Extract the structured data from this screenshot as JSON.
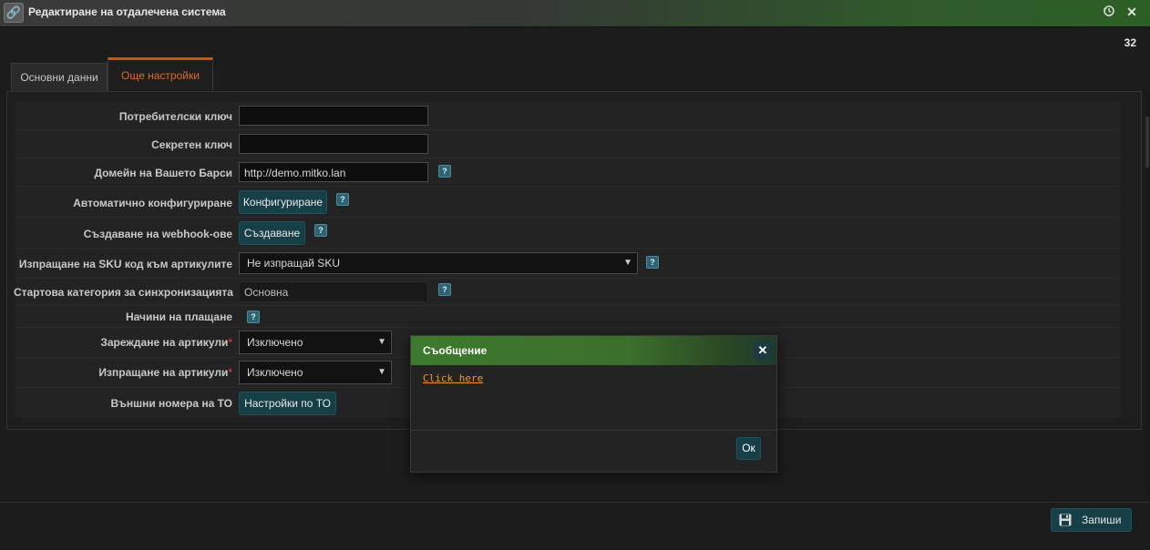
{
  "window": {
    "title": "Редактиране на отдалечена система",
    "record_id": "32"
  },
  "tabs": [
    {
      "label": "Основни данни",
      "active": false
    },
    {
      "label": "Още настройки",
      "active": true
    }
  ],
  "form": {
    "consumer_key": {
      "label": "Потребителски ключ",
      "value": ""
    },
    "secret_key": {
      "label": "Секретен ключ",
      "value": ""
    },
    "domain": {
      "label": "Домейн на Вашето Барси",
      "value": "http://demo.mitko.lan"
    },
    "auto_config": {
      "label": "Автоматично конфигуриране",
      "button": "Конфигуриране"
    },
    "webhooks": {
      "label": "Създаване на webhook-ове",
      "button": "Създаване"
    },
    "send_sku": {
      "label": "Изпращане на SKU код към артикулите",
      "value": "Не изпращай SKU"
    },
    "start_category": {
      "label": "Стартова категория за синхронизацията",
      "value": "Основна"
    },
    "payment_methods": {
      "label": "Начини на плащане"
    },
    "load_products": {
      "label": "Зареждане на артикули",
      "value": "Изключено"
    },
    "send_products": {
      "label": "Изпращане на артикули",
      "value": "Изключено"
    },
    "external_numbers": {
      "label": "Външни номера на ТО",
      "button": "Настройки по ТО"
    },
    "required_mark": "*",
    "help_mark": "?"
  },
  "footer": {
    "save_label": "Запиши"
  },
  "modal": {
    "title": "Съобщение",
    "link": "Click here",
    "ok_label": "Ок"
  },
  "colors": {
    "accent_tab": "#e06a25",
    "button_bg": "#163f48",
    "modal_header": "#3d7a2e",
    "link": "#e89a2e",
    "required": "#d03030"
  }
}
